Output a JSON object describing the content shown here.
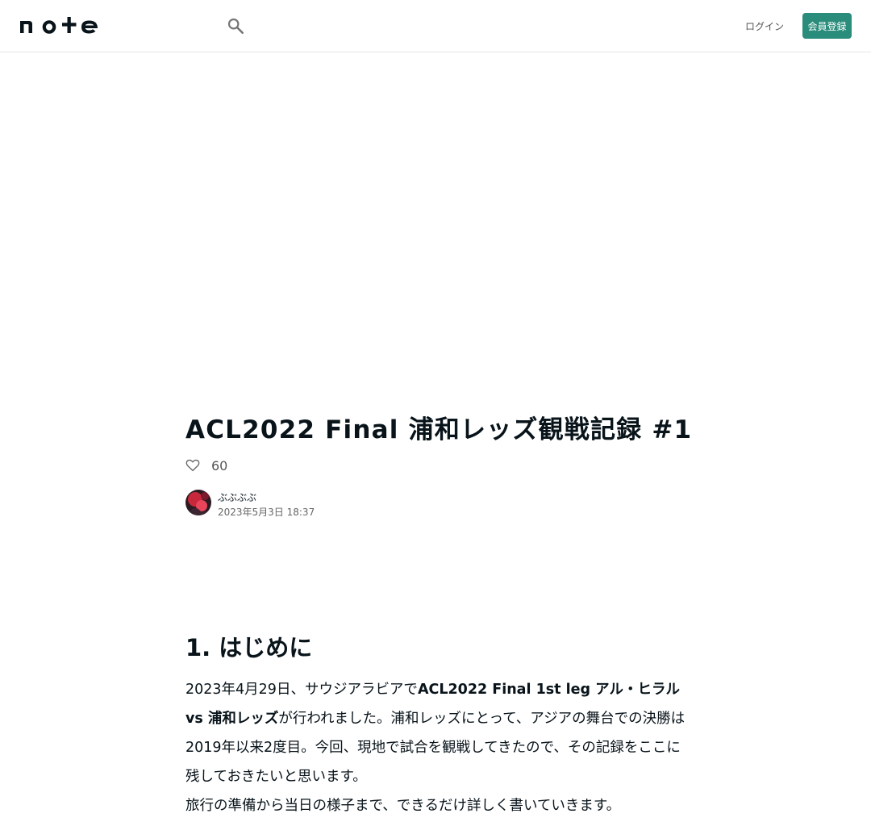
{
  "header": {
    "logo_text": "note",
    "icons": {
      "search": "search-icon"
    },
    "login_label": "ログイン",
    "signup_label": "会員登録",
    "accent_color": "#2a8c7a"
  },
  "article": {
    "title": "ACL2022 Final 浦和レッズ観戦記録 #1",
    "like_count": "60",
    "author_name": "ぶぶぶぶ",
    "date": "2023年5月3日 18:37",
    "section_heading": "1. はじめに",
    "paragraph1_pre": "2023年4月29日、サウジアラビアで",
    "paragraph1_bold": "ACL2022 Final 1st leg アル・ヒラル vs 浦和レッズ",
    "paragraph1_post": "が行われました。浦和レッズにとって、アジアの舞台での決勝は2019年以来2度目。今回、現地で試合を観戦してきたので、その記録をここに残しておきたいと思います。",
    "paragraph2": "旅行の準備から当日の様子まで、できるだけ詳しく書いていきます。"
  }
}
